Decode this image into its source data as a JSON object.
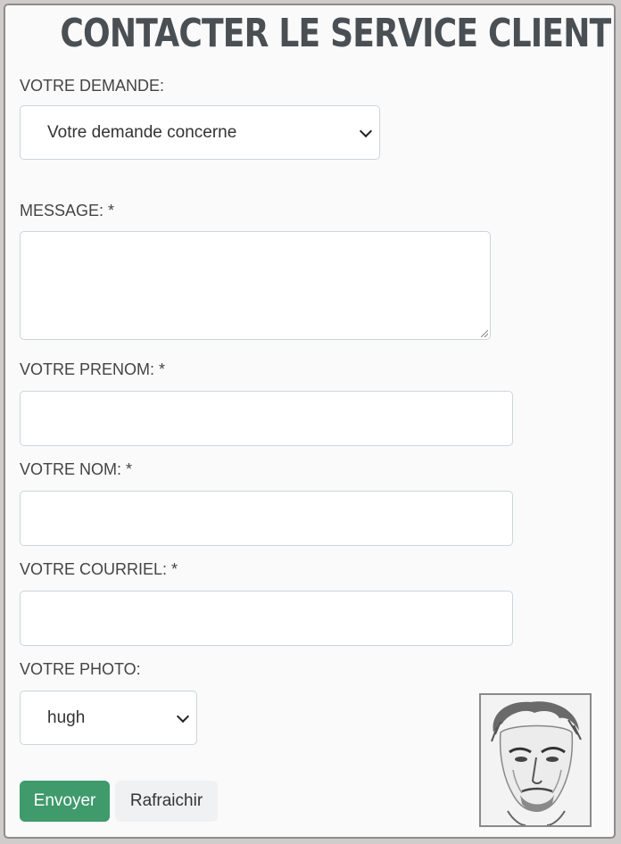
{
  "form": {
    "title": "CONTACTER LE SERVICE CLIENT",
    "request_label": "VOTRE DEMANDE:",
    "request_select_value": "Votre demande concerne",
    "message_label": "MESSAGE: *",
    "message_value": "",
    "firstname_label": "VOTRE PRENOM: *",
    "firstname_value": "",
    "lastname_label": "VOTRE NOM: *",
    "lastname_value": "",
    "email_label": "VOTRE COURRIEL: *",
    "email_value": "",
    "photo_label": "VOTRE PHOTO:",
    "photo_select_value": "hugh",
    "submit_label": "Envoyer",
    "refresh_label": "Rafraichir"
  },
  "colors": {
    "title": "#4a4f54",
    "primary_button": "#3f9a6c",
    "secondary_button": "#f0f1f3",
    "input_border": "#ced4da"
  },
  "icons": {
    "select_chevron": "chevron-down-icon",
    "textarea_resize": "resize-handle-icon",
    "photo_preview": "portrait-sketch"
  }
}
